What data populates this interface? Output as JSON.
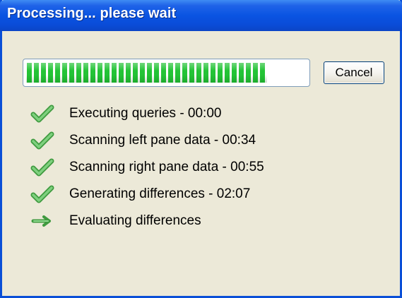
{
  "window": {
    "title": "Processing... please wait"
  },
  "progress": {
    "fraction": 0.86,
    "fill_color": "#23c336"
  },
  "cancel_button": {
    "label": "Cancel"
  },
  "steps": [
    {
      "label": "Executing queries - 00:00",
      "status": "done",
      "icon": "checkmark-icon"
    },
    {
      "label": "Scanning left pane data - 00:34",
      "status": "done",
      "icon": "checkmark-icon"
    },
    {
      "label": "Scanning right pane data - 00:55",
      "status": "done",
      "icon": "checkmark-icon"
    },
    {
      "label": "Generating differences - 02:07",
      "status": "done",
      "icon": "checkmark-icon"
    },
    {
      "label": "Evaluating differences",
      "status": "in-progress",
      "icon": "arrow-right-icon"
    }
  ],
  "colors": {
    "titlebar": "#0a54e2",
    "dialog_background": "#ece9d8",
    "check_green": "#5cb85c",
    "arrow_green": "#4caf50"
  }
}
